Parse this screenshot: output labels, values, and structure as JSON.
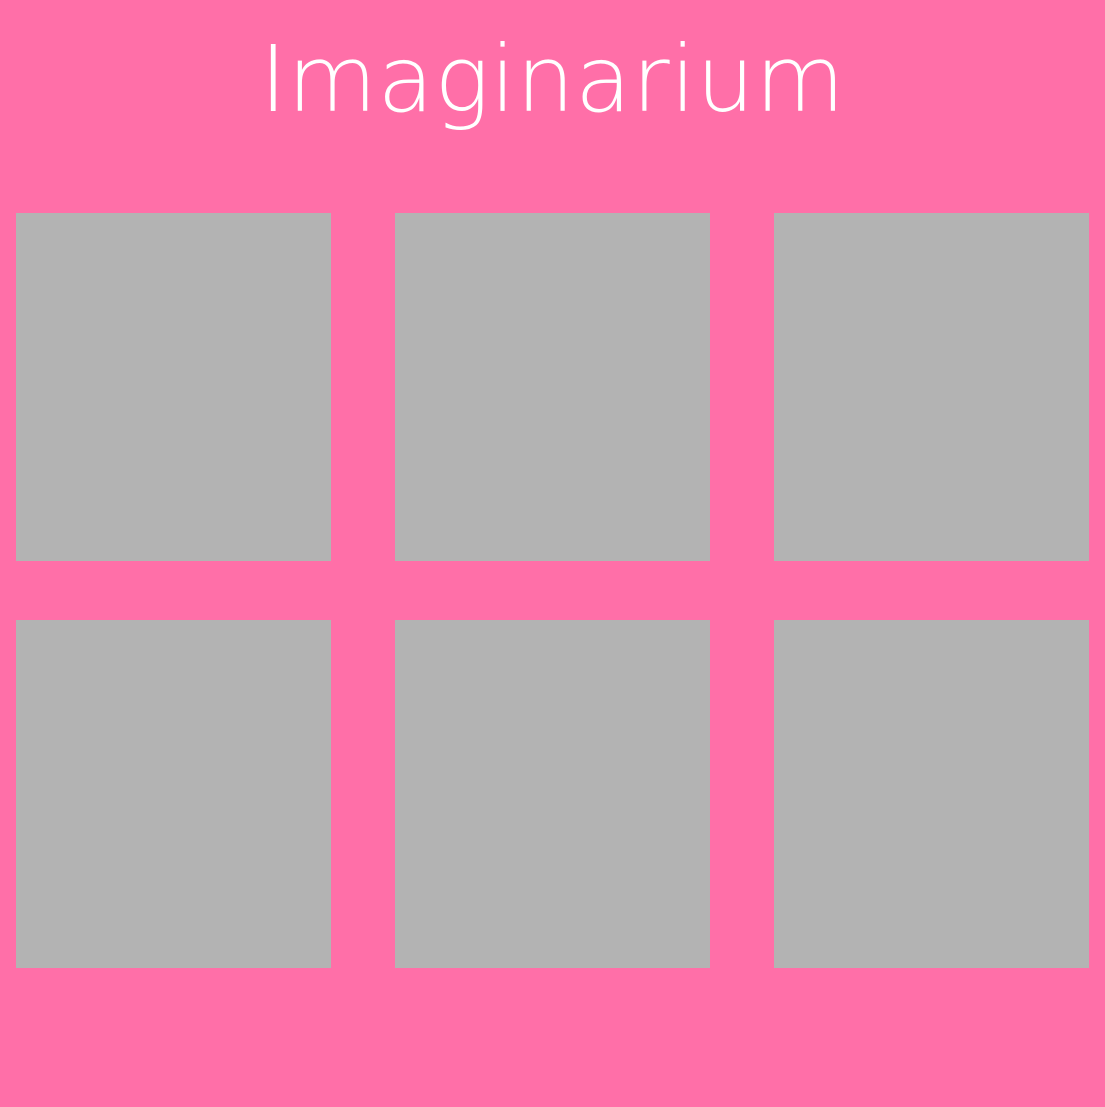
{
  "app": {
    "title": "Imaginarium"
  },
  "colors": {
    "background": "#ff6fa8",
    "tile": "#b3b3b3",
    "title_text": "#ffffff"
  },
  "grid": {
    "tiles": [
      {
        "type": "image-placeholder"
      },
      {
        "type": "image-placeholder"
      },
      {
        "type": "image-placeholder"
      },
      {
        "type": "image-placeholder"
      },
      {
        "type": "image-placeholder"
      },
      {
        "type": "image-placeholder"
      }
    ]
  }
}
